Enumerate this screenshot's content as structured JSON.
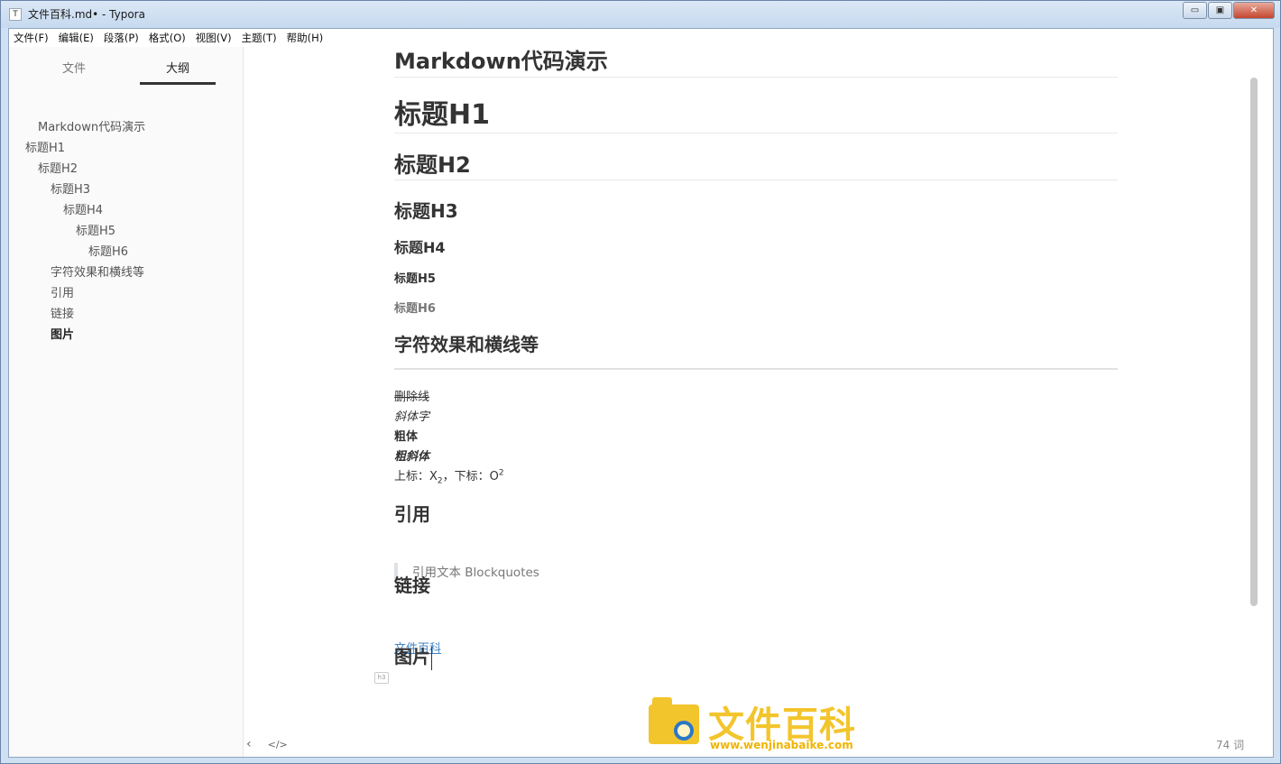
{
  "window": {
    "title": "文件百科.md• - Typora",
    "app_icon": "T"
  },
  "window_controls": {
    "minimize": "▭",
    "maximize": "▣",
    "close": "✕"
  },
  "menubar": [
    "文件(F)",
    "编辑(E)",
    "段落(P)",
    "格式(O)",
    "视图(V)",
    "主题(T)",
    "帮助(H)"
  ],
  "sidebar": {
    "tabs": [
      {
        "label": "文件",
        "active": false
      },
      {
        "label": "大纲",
        "active": true
      }
    ],
    "outline": [
      {
        "label": "Markdown代码演示",
        "level": 2
      },
      {
        "label": "标题H1",
        "level": 1
      },
      {
        "label": "标题H2",
        "level": 2
      },
      {
        "label": "标题H3",
        "level": 3
      },
      {
        "label": "标题H4",
        "level": 4
      },
      {
        "label": "标题H5",
        "level": 5
      },
      {
        "label": "标题H6",
        "level": 6
      },
      {
        "label": "字符效果和横线等",
        "level": 3
      },
      {
        "label": "引用",
        "level": 3
      },
      {
        "label": "链接",
        "level": 3
      },
      {
        "label": "图片",
        "level": 3,
        "active": true
      }
    ]
  },
  "document": {
    "heading_main": "Markdown代码演示",
    "h1": "标题H1",
    "h2": "标题H2",
    "h3": "标题H3",
    "h4": "标题H4",
    "h5": "标题H5",
    "h6": "标题H6",
    "effects_heading": "字符效果和横线等",
    "strikethrough": "删除线",
    "italic": "斜体字",
    "bold": "粗体",
    "bold_italic": "粗斜体",
    "sup_sub_prefix": "上标：X",
    "sub_text": "2",
    "sup_sub_middle": "，下标：O",
    "sup_text": "2",
    "quote_heading": "引用",
    "quote_text": "引用文本 Blockquotes",
    "link_heading": "链接",
    "link_text": "文件百科",
    "image_heading": "图片",
    "heading_marker": "h3"
  },
  "footer": {
    "word_count": "74 词",
    "back_icon": "‹",
    "source_icon": "</>"
  },
  "watermark": {
    "title": "文件百科",
    "url": "www.wenjinabaike.com"
  }
}
